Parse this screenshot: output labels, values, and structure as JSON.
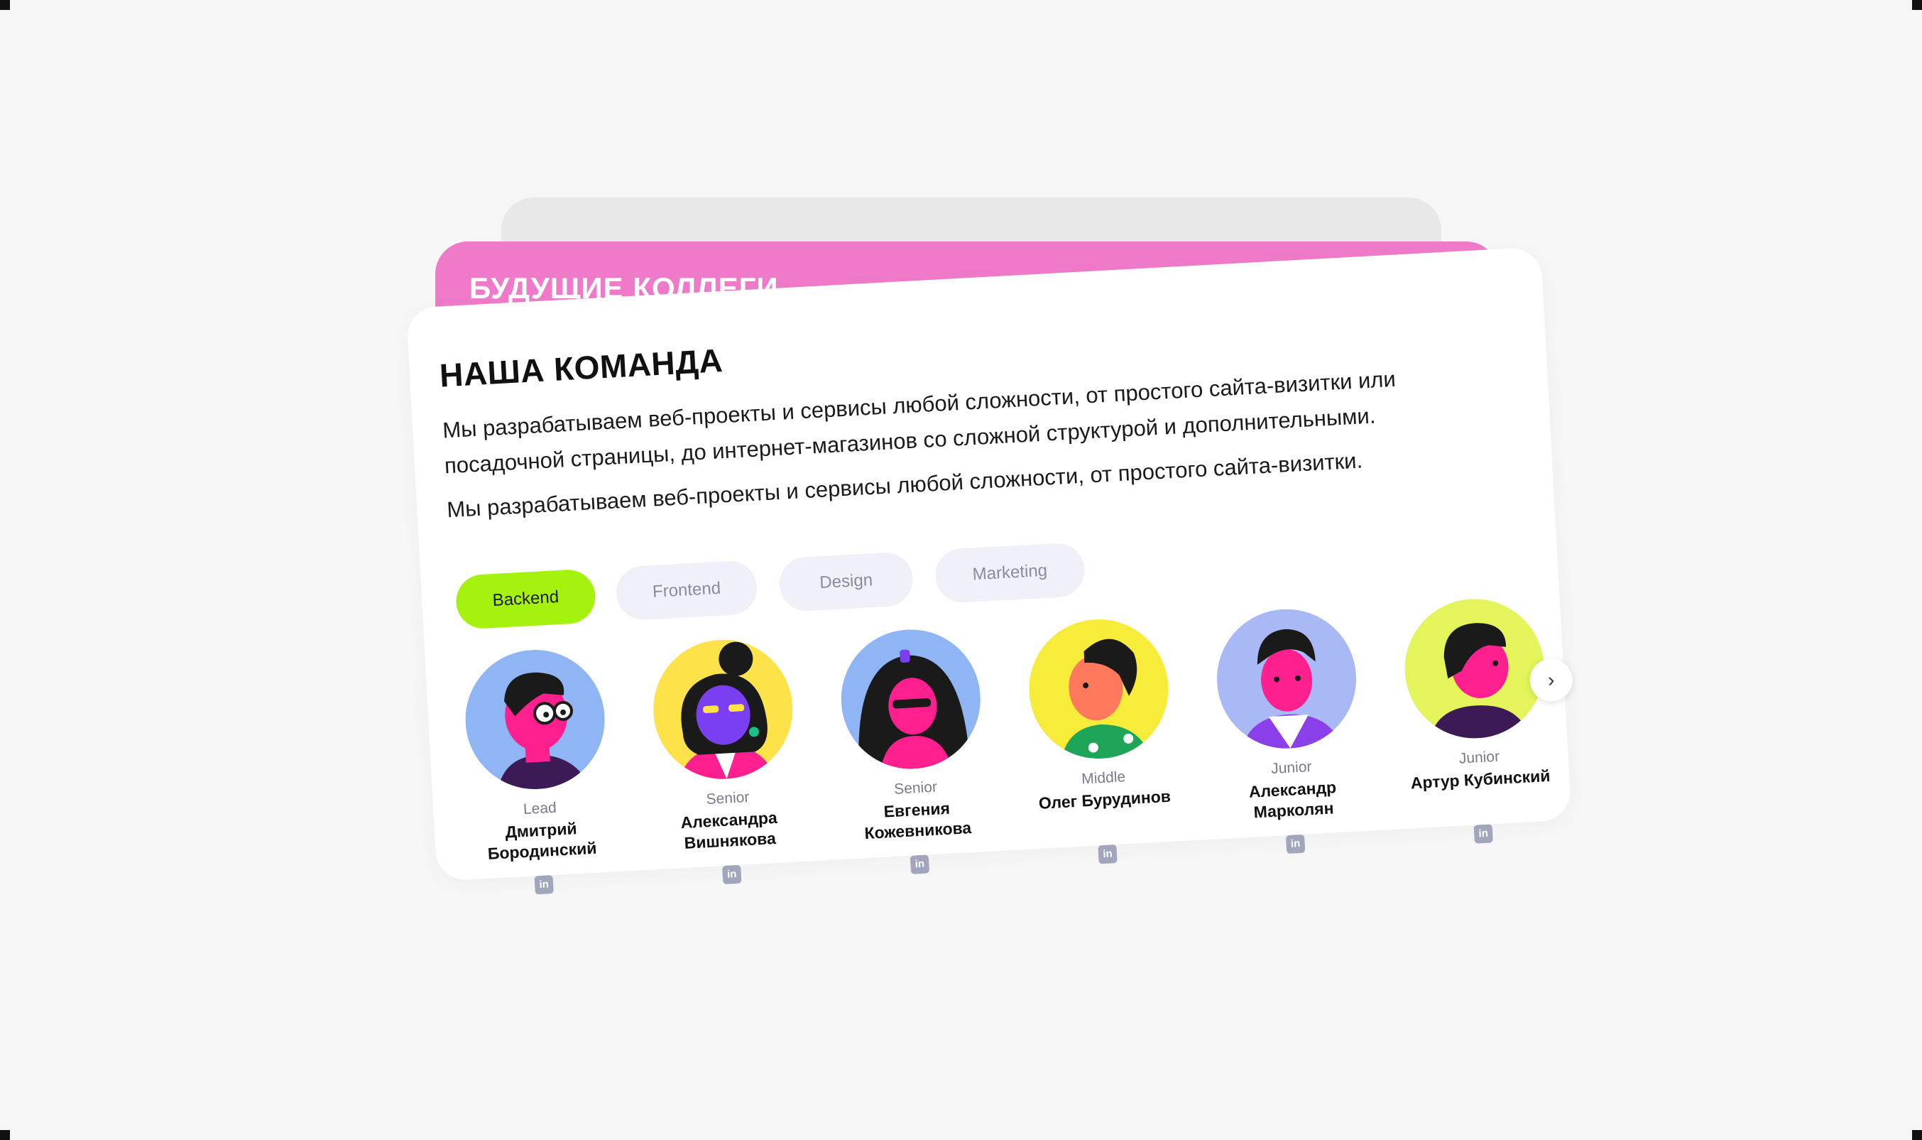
{
  "pink_card": {
    "title": "БУДУЩИЕ КОЛЛЕГИ"
  },
  "main_card": {
    "title": "НАША КОМАНДА",
    "description_1": "Мы разрабатываем веб-проекты и сервисы любой сложности, от простого сайта-визитки или посадочной страницы, до интернет-магазинов со сложной структурой и дополнительными.",
    "description_2": "Мы разрабатываем веб-проекты и сервисы любой сложности, от простого сайта-визитки."
  },
  "tabs": [
    {
      "label": "Backend",
      "active": true
    },
    {
      "label": "Frontend",
      "active": false
    },
    {
      "label": "Design",
      "active": false
    },
    {
      "label": "Marketing",
      "active": false
    }
  ],
  "members": [
    {
      "level": "Lead",
      "name": "Дмитрий Бородинский",
      "avatar_bg": "#8fb5f5",
      "linkedin_icon": "linkedin-icon"
    },
    {
      "level": "Senior",
      "name": "Александра Вишнякова",
      "avatar_bg": "#fde24a",
      "linkedin_icon": "linkedin-icon"
    },
    {
      "level": "Senior",
      "name": "Евгения Кожевникова",
      "avatar_bg": "#8fb5f5",
      "linkedin_icon": "linkedin-icon"
    },
    {
      "level": "Middle",
      "name": "Олег Бурудинов",
      "avatar_bg": "#f7ec3a",
      "linkedin_icon": "linkedin-icon"
    },
    {
      "level": "Junior",
      "name": "Александр Марколян",
      "avatar_bg": "#a9b9f6",
      "linkedin_icon": "linkedin-icon"
    },
    {
      "level": "Junior",
      "name": "Артур Кубинский",
      "avatar_bg": "#e3f55a",
      "linkedin_icon": "linkedin-icon"
    }
  ],
  "carousel": {
    "next_icon": "chevron-right-icon",
    "linkedin_label": "in"
  },
  "colors": {
    "accent_green": "#a6f20f",
    "pink": "#ef7ac9",
    "background": "#f6f6f6"
  }
}
